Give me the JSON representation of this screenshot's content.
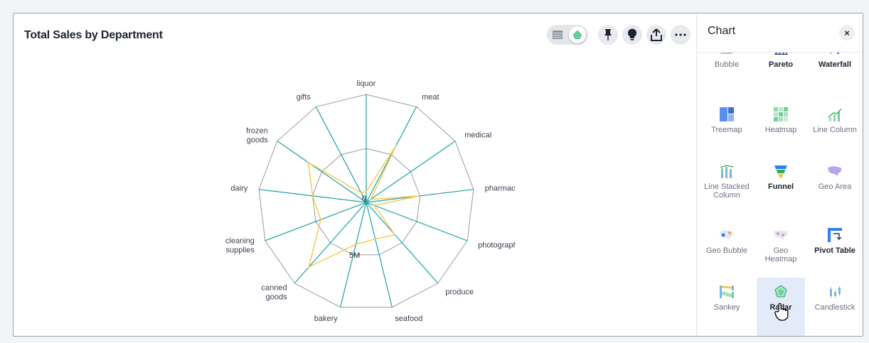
{
  "title": "Total Sales by Department",
  "toolbar": {
    "view_toggle": [
      "table-icon",
      "chart-icon"
    ],
    "buttons": [
      "pin-icon",
      "lightbulb-icon",
      "share-icon",
      "more-icon"
    ]
  },
  "chart_data": {
    "type": "radar",
    "categories": [
      "liquor",
      "meat",
      "medical",
      "pharmacy",
      "photography",
      "produce",
      "seafood",
      "bakery",
      "canned goods",
      "cleaning supplies",
      "dairy",
      "frozen goods",
      "gifts"
    ],
    "rings": [
      "0",
      "5M"
    ],
    "series": [
      {
        "values": [
          1,
          6,
          0.5,
          5,
          0.8,
          4,
          3.5,
          4,
          8,
          4.5,
          5,
          6.5,
          1
        ]
      },
      {
        "values": [
          10,
          10,
          10,
          10,
          10,
          10,
          10,
          10,
          10,
          10,
          10,
          10,
          10
        ]
      }
    ],
    "rmax": 10,
    "colors": {
      "series": [
        "#f2c94c",
        "#1aa3a3"
      ],
      "grid": "#9a9aa0"
    }
  },
  "panel": {
    "title": "Chart",
    "close": "×",
    "tiles": [
      {
        "label": "Bubble",
        "icon": "bubble-chart-icon",
        "enabled": false
      },
      {
        "label": "Pareto",
        "icon": "pareto-chart-icon",
        "enabled": true
      },
      {
        "label": "Waterfall",
        "icon": "waterfall-chart-icon",
        "enabled": true
      },
      {
        "label": "Treemap",
        "icon": "treemap-chart-icon",
        "enabled": false
      },
      {
        "label": "Heatmap",
        "icon": "heatmap-chart-icon",
        "enabled": false
      },
      {
        "label": "Line Column",
        "icon": "line-column-chart-icon",
        "enabled": false
      },
      {
        "label": "Line Stacked Column",
        "icon": "line-stacked-column-chart-icon",
        "enabled": false
      },
      {
        "label": "Funnel",
        "icon": "funnel-chart-icon",
        "enabled": true
      },
      {
        "label": "Geo Area",
        "icon": "geo-area-chart-icon",
        "enabled": false
      },
      {
        "label": "Geo Bubble",
        "icon": "geo-bubble-chart-icon",
        "enabled": false
      },
      {
        "label": "Geo Heatmap",
        "icon": "geo-heatmap-chart-icon",
        "enabled": false
      },
      {
        "label": "Pivot Table",
        "icon": "pivot-table-icon",
        "enabled": true
      },
      {
        "label": "Sankey",
        "icon": "sankey-chart-icon",
        "enabled": false
      },
      {
        "label": "Radar",
        "icon": "radar-chart-icon",
        "enabled": true,
        "selected": true
      },
      {
        "label": "Candlestick",
        "icon": "candlestick-chart-icon",
        "enabled": false
      }
    ]
  }
}
